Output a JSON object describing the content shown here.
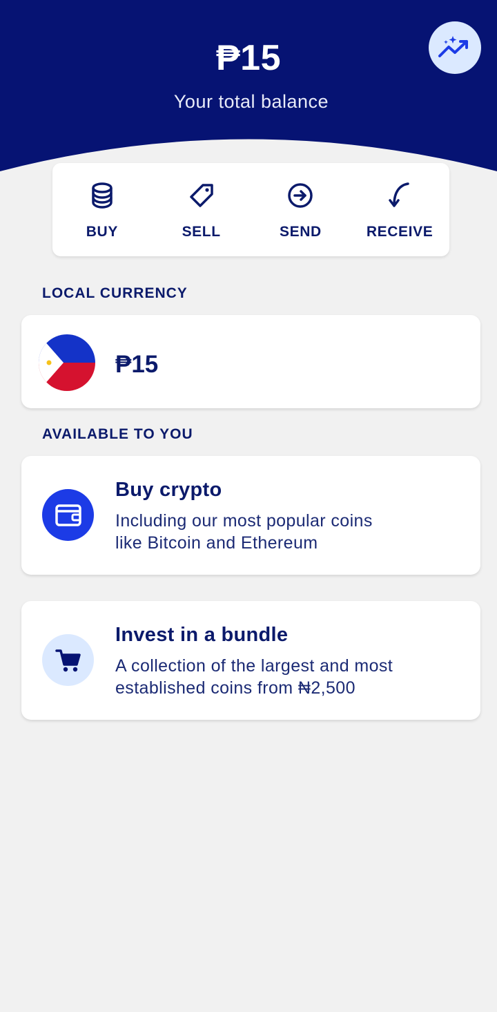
{
  "header": {
    "balance": "₱15",
    "caption": "Your total balance",
    "insights_icon": "sparkle-trend-icon"
  },
  "actions": [
    {
      "label": "BUY",
      "icon": "coins-stack-icon"
    },
    {
      "label": "SELL",
      "icon": "price-tag-icon"
    },
    {
      "label": "SEND",
      "icon": "arrow-circle-right-icon"
    },
    {
      "label": "RECEIVE",
      "icon": "curved-arrow-down-icon"
    }
  ],
  "local_currency": {
    "section_title": "LOCAL CURRENCY",
    "flag_icon": "philippines-flag-icon",
    "amount": "₱15"
  },
  "available": {
    "section_title": "AVAILABLE TO YOU",
    "items": [
      {
        "title": "Buy crypto",
        "desc_line1": "Including our most popular coins",
        "desc_line2": "like Bitcoin and Ethereum",
        "icon": "wallet-icon"
      },
      {
        "title": "Invest in a bundle",
        "desc_line1": "A collection of the largest and most",
        "desc_line2": "established coins from ₦2,500",
        "icon": "shopping-cart-icon"
      }
    ]
  },
  "colors": {
    "header_navy": "#061373",
    "text_navy": "#0b1a6b",
    "accent_blue": "#1c3be6",
    "light_blue": "#dbe9ff",
    "background": "#f1f1f1"
  }
}
